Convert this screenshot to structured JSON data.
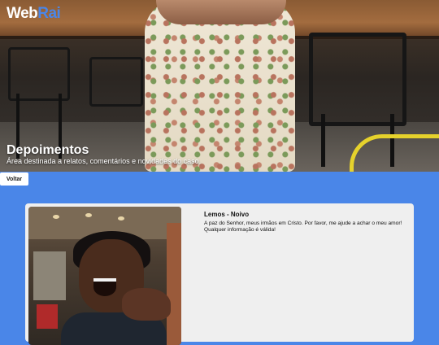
{
  "header": {
    "logo_part1": "Web",
    "logo_part2": "Rai"
  },
  "hero": {
    "title": "Depoimentos",
    "subtitle": "Área destinada a relatos, comentários e novidades do caso."
  },
  "actions": {
    "back_label": "Voltar"
  },
  "testimonial": {
    "author": "Lemos - Noivo",
    "text": "A paz do Senhor, meus irmãos em Cristo. Por favor, me ajude a achar o meu amor! Qualquer informação é válida!"
  },
  "colors": {
    "accent": "#4a86e8",
    "card_bg": "#efefef"
  }
}
